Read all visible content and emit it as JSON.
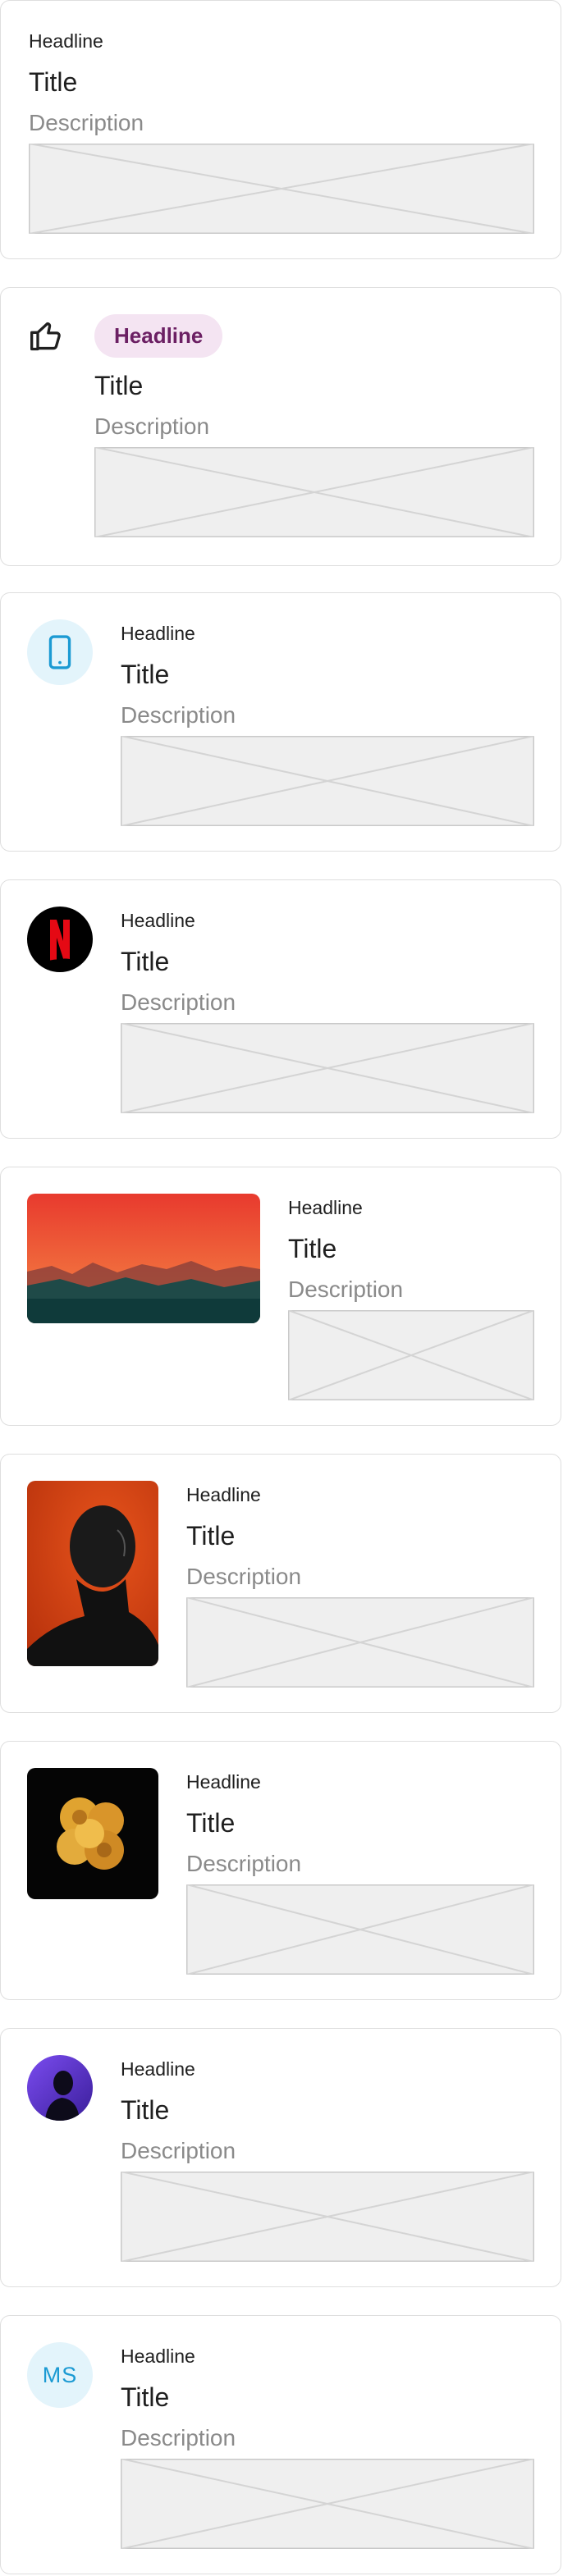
{
  "cards": [
    {
      "variant": "plain",
      "headline": "Headline",
      "title": "Title",
      "description": "Description"
    },
    {
      "variant": "icon-chip",
      "leading_icon": "thumbs-up-icon",
      "headline": "Headline",
      "title": "Title",
      "description": "Description"
    },
    {
      "variant": "icon-circle",
      "leading_icon": "smartphone-icon",
      "headline": "Headline",
      "title": "Title",
      "description": "Description"
    },
    {
      "variant": "logo",
      "leading_icon": "netflix-logo",
      "headline": "Headline",
      "title": "Title",
      "description": "Description"
    },
    {
      "variant": "landscape-image",
      "image": "sunset-mountains-image",
      "headline": "Headline",
      "title": "Title",
      "description": "Description"
    },
    {
      "variant": "portrait-image",
      "image": "man-portrait-image",
      "headline": "Headline",
      "title": "Title",
      "description": "Description"
    },
    {
      "variant": "square-image",
      "image": "yellow-roses-image",
      "headline": "Headline",
      "title": "Title",
      "description": "Description"
    },
    {
      "variant": "avatar",
      "image": "silhouette-avatar",
      "headline": "Headline",
      "title": "Title",
      "description": "Description"
    },
    {
      "variant": "initials",
      "initials": "MS",
      "headline": "Headline",
      "title": "Title",
      "description": "Description"
    }
  ],
  "colors": {
    "chip_bg": "#f4e4f2",
    "chip_text": "#6b1f63",
    "accent_teal": "#1b9ad3",
    "placeholder_bg": "#efefef",
    "placeholder_stroke": "#c9c9c9"
  }
}
